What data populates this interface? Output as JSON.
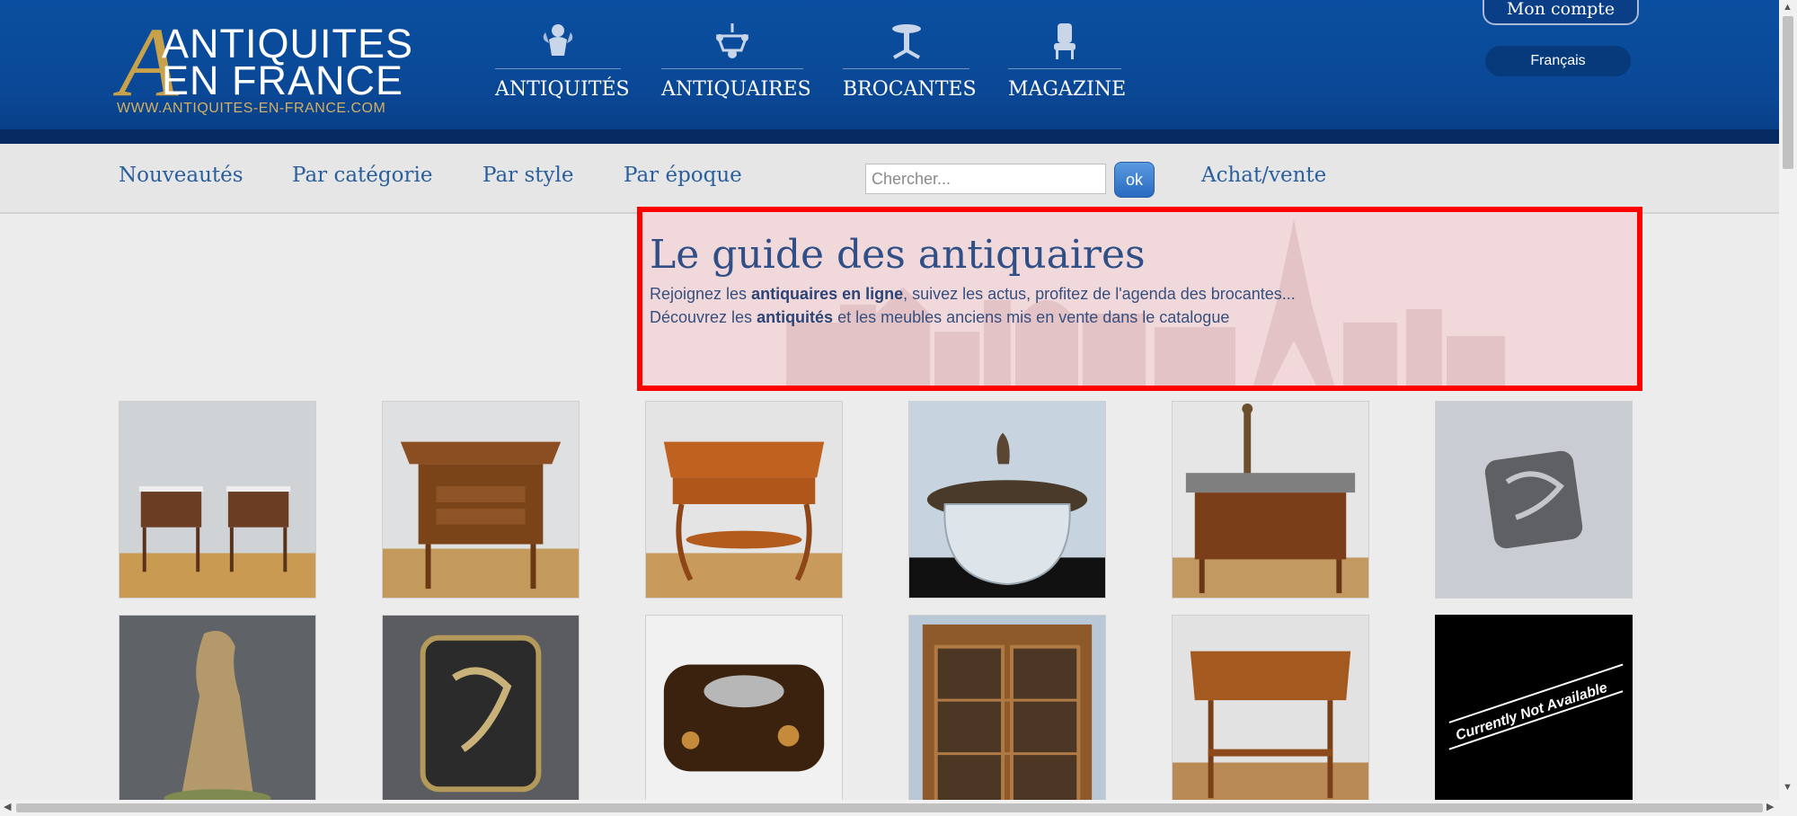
{
  "header": {
    "logo": {
      "line1": "ANTIQUITES",
      "line2": "EN FRANCE",
      "url": "WWW.ANTIQUITES-EN-FRANCE.COM",
      "big_letter": "A"
    },
    "nav": [
      {
        "label": "ANTIQUITÉS",
        "icon": "cherub-icon"
      },
      {
        "label": "ANTIQUAIRES",
        "icon": "chandelier-icon"
      },
      {
        "label": "BROCANTES",
        "icon": "pedestal-table-icon"
      },
      {
        "label": "MAGAZINE",
        "icon": "armchair-icon"
      }
    ],
    "account_label": "Mon compte",
    "language_label": "Français"
  },
  "subnav": {
    "links": [
      "Nouveautés",
      "Par catégorie",
      "Par style",
      "Par époque"
    ],
    "search_placeholder": "Chercher...",
    "search_button": "ok",
    "sell_link": "Achat/vente"
  },
  "hero": {
    "title": "Le guide des antiquaires",
    "line1": {
      "a": "Rejoignez les ",
      "b": "antiquaires en ligne",
      "c": ", suivez les actus, profitez de l'agenda des brocantes..."
    },
    "line2": {
      "a": "Découvrez les ",
      "b": "antiquités",
      "c": " et les meubles anciens mis en vente dans le catalogue"
    }
  },
  "products": [
    {
      "name": "pair-of-bedside-tables"
    },
    {
      "name": "walnut-chest-of-drawers"
    },
    {
      "name": "marquetry-side-table"
    },
    {
      "name": "crystal-biscuit-jar"
    },
    {
      "name": "marble-top-commode-with-statue"
    },
    {
      "name": "silver-dragon-cigarette-case"
    },
    {
      "name": "bronze-couple-sculpture"
    },
    {
      "name": "silver-relief-vesta-case"
    },
    {
      "name": "tortoiseshell-box"
    },
    {
      "name": "glazed-display-cabinet"
    },
    {
      "name": "inlaid-art-nouveau-table"
    },
    {
      "name": "currently-not-available",
      "overlay_text": "Currently Not Available"
    }
  ],
  "colors": {
    "header_blue": "#0a4896",
    "gold": "#c8a24a",
    "link_blue": "#2a5f9e",
    "hero_border": "#ff0000"
  }
}
